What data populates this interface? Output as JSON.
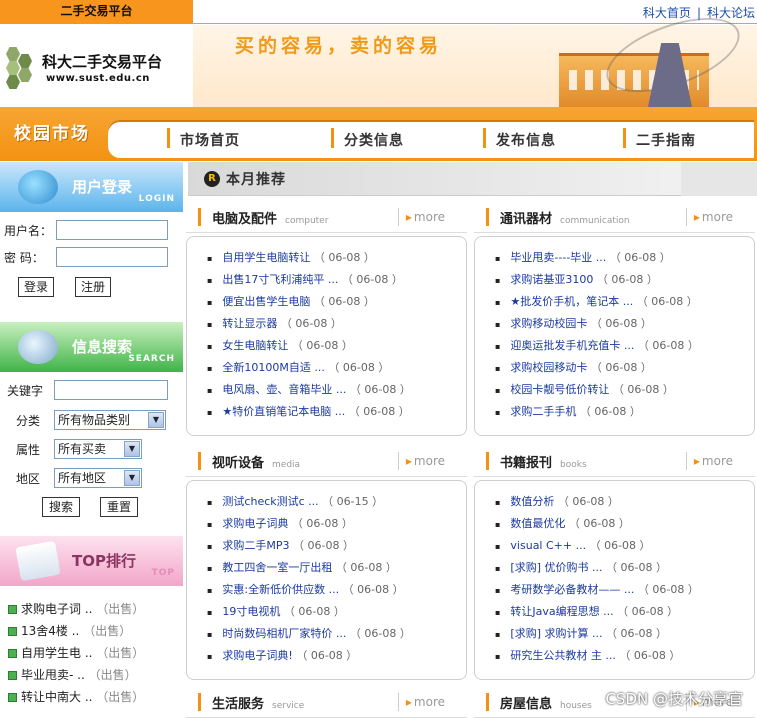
{
  "top": {
    "tag": "二手交易平台",
    "links": [
      "科大首页",
      "科大论坛"
    ]
  },
  "banner": {
    "site_name": "科大二手交易平台",
    "url": "www.sust.edu.cn",
    "slogan": "买的容易，卖的容易"
  },
  "nav": {
    "market": "校园市场",
    "items": [
      "市场首页",
      "分类信息",
      "发布信息",
      "二手指南"
    ]
  },
  "login": {
    "title": "用户登录",
    "sub": "LOGIN",
    "username_label": "用户名：",
    "password_label": "密  码：",
    "login_btn": "登录",
    "register_btn": "注册"
  },
  "search": {
    "title": "信息搜索",
    "sub": "SEARCH",
    "keyword_label": "关键字",
    "category_label": "分类",
    "category_value": "所有物品类别",
    "attr_label": "属性",
    "attr_value": "所有买卖",
    "region_label": "地区",
    "region_value": "所有地区",
    "search_btn": "搜索",
    "reset_btn": "重置"
  },
  "top_rank": {
    "title": "TOP排行",
    "sub": "TOP",
    "items": [
      {
        "text": "求购电子词 ..",
        "tail": "（出售）"
      },
      {
        "text": "13舍4楼 ..",
        "tail": "（出售）"
      },
      {
        "text": "自用学生电 ..",
        "tail": "（出售）"
      },
      {
        "text": "毕业甩卖- ..",
        "tail": "（出售）"
      },
      {
        "text": "转让中南大 ..",
        "tail": "（出售）"
      }
    ]
  },
  "recommend": {
    "title": "本月推荐",
    "dot": "R"
  },
  "sections": [
    {
      "name": "电脑及配件",
      "en": "computer",
      "more": "more",
      "items": [
        {
          "t": "自用学生电脑转让",
          "d": "（ 06-08 ）"
        },
        {
          "t": "出售17寸飞利浦纯平 ...",
          "d": "（ 06-08 ）"
        },
        {
          "t": "便宜出售学生电脑",
          "d": "（ 06-08 ）"
        },
        {
          "t": "转让显示器",
          "d": "（ 06-08 ）"
        },
        {
          "t": "女生电脑转让",
          "d": "（ 06-08 ）"
        },
        {
          "t": "全新10100M自适 ...",
          "d": "（ 06-08 ）"
        },
        {
          "t": "电风扇、壶、音箱毕业 ...",
          "d": "（ 06-08 ）"
        },
        {
          "t": "★特价直销笔记本电脑 ...",
          "d": "（ 06-08 ）"
        }
      ]
    },
    {
      "name": "通讯器材",
      "en": "communication",
      "more": "more",
      "items": [
        {
          "t": "毕业甩卖----毕业 ...",
          "d": "（ 06-08 ）"
        },
        {
          "t": "求购诺基亚3100",
          "d": "（ 06-08 ）"
        },
        {
          "t": "★批发价手机，笔记本 ...",
          "d": "（ 06-08 ）"
        },
        {
          "t": "求购移动校园卡",
          "d": "（ 06-08 ）"
        },
        {
          "t": "迎奥运批发手机充值卡 ...",
          "d": "（ 06-08 ）"
        },
        {
          "t": "求购校园移动卡",
          "d": "（ 06-08 ）"
        },
        {
          "t": "校园卡靓号低价转让",
          "d": "（ 06-08 ）"
        },
        {
          "t": "求购二手手机",
          "d": "（ 06-08 ）"
        }
      ]
    },
    {
      "name": "视听设备",
      "en": "media",
      "more": "more",
      "items": [
        {
          "t": "测试check测试c ...",
          "d": "（ 06-15 ）"
        },
        {
          "t": "求购电子词典",
          "d": "（ 06-08 ）"
        },
        {
          "t": "求购二手MP3",
          "d": "（ 06-08 ）"
        },
        {
          "t": "教工四舍一室一厅出租",
          "d": "（ 06-08 ）"
        },
        {
          "t": "实惠:全新低价供应数 ...",
          "d": "（ 06-08 ）"
        },
        {
          "t": "19寸电视机",
          "d": "（ 06-08 ）"
        },
        {
          "t": "时尚数码相机厂家特价 ...",
          "d": "（ 06-08 ）"
        },
        {
          "t": "求购电子词典!",
          "d": "（ 06-08 ）"
        }
      ]
    },
    {
      "name": "书籍报刊",
      "en": "books",
      "more": "more",
      "items": [
        {
          "t": "数值分析",
          "d": "（ 06-08 ）"
        },
        {
          "t": "数值最优化",
          "d": "（ 06-08 ）"
        },
        {
          "t": "visual C++ ...",
          "d": "（ 06-08 ）"
        },
        {
          "t": "[求购] 优价购书 ...",
          "d": "（ 06-08 ）"
        },
        {
          "t": "考研数学必备教材—— ...",
          "d": "（ 06-08 ）"
        },
        {
          "t": "转让Java编程思想 ...",
          "d": "（ 06-08 ）"
        },
        {
          "t": "[求购] 求购计算 ...",
          "d": "（ 06-08 ）"
        },
        {
          "t": "研究生公共教材 主 ...",
          "d": "（ 06-08 ）"
        }
      ]
    },
    {
      "name": "生活服务",
      "en": "service",
      "more": "more",
      "items": []
    },
    {
      "name": "房屋信息",
      "en": "houses",
      "more": "more",
      "items": []
    }
  ],
  "watermark": "CSDN @技术分享官",
  "colors": {
    "accent": "#f39212",
    "link": "#1b3aa0"
  }
}
